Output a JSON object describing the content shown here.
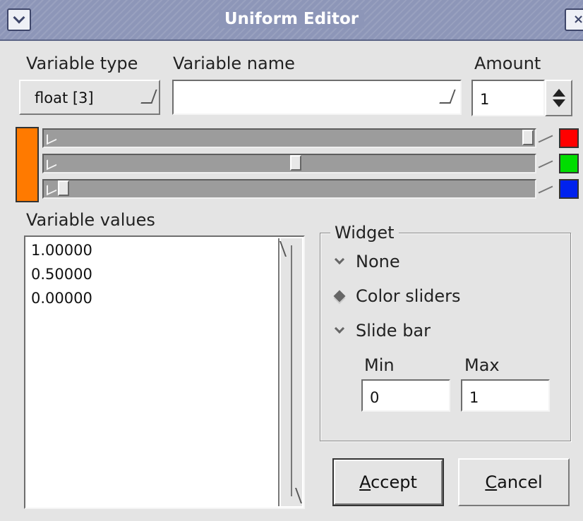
{
  "window": {
    "title": "Uniform Editor",
    "menu_icon": "chevron-down-icon",
    "close_icon": "close-icon",
    "close_glyph": "×"
  },
  "form": {
    "variable_type_label": "Variable type",
    "variable_type_value": "float [3]",
    "variable_name_label": "Variable name",
    "variable_name_value": "",
    "amount_label": "Amount",
    "amount_value": "1"
  },
  "color": {
    "swatch": "#ff7a00",
    "channels": [
      {
        "name": "red",
        "color": "#ff0000",
        "value": 1.0
      },
      {
        "name": "green",
        "color": "#00dd00",
        "value": 0.5
      },
      {
        "name": "blue",
        "color": "#0022ee",
        "value": 0.0
      }
    ]
  },
  "values": {
    "label": "Variable values",
    "items": [
      "1.00000",
      "0.50000",
      "0.00000"
    ]
  },
  "widget": {
    "title": "Widget",
    "options": [
      {
        "label": "None",
        "selected": false
      },
      {
        "label": "Color sliders",
        "selected": true
      },
      {
        "label": "Slide bar",
        "selected": false
      }
    ],
    "min_label": "Min",
    "max_label": "Max",
    "min_value": "0",
    "max_value": "1"
  },
  "buttons": {
    "accept_mnemonic": "A",
    "accept_rest": "ccept",
    "cancel_mnemonic": "C",
    "cancel_rest": "ancel"
  }
}
